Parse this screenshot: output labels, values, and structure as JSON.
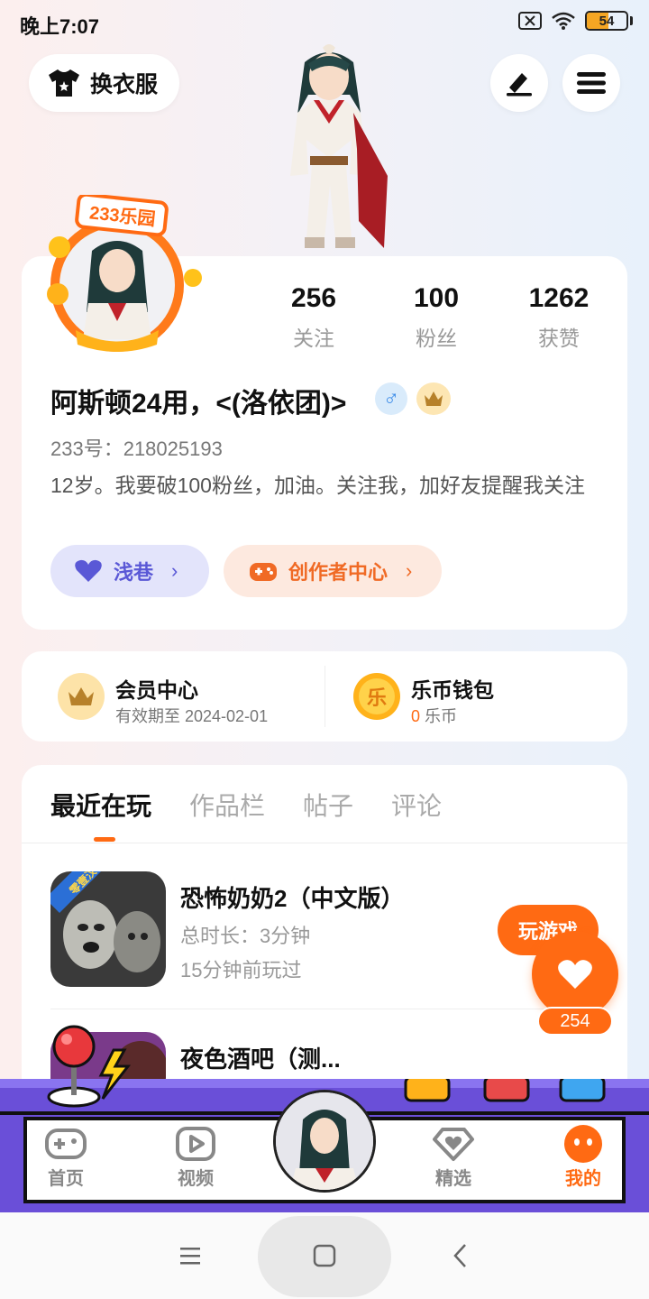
{
  "status_bar": {
    "time": "晚上7:07",
    "battery": "54"
  },
  "header": {
    "outfit_label": "换衣服"
  },
  "stats": [
    {
      "value": "256",
      "label": "关注"
    },
    {
      "value": "100",
      "label": "粉丝"
    },
    {
      "value": "1262",
      "label": "获赞"
    }
  ],
  "profile": {
    "badge_text": "233乐园",
    "nickname": "阿斯顿24用，<(洛依团)>",
    "gender_symbol": "♂",
    "uid": "233号：218025193",
    "bio": "12岁。我要破100粉丝，加油。关注我，加好友提醒我关注",
    "lane_label": "浅巷",
    "creator_label": "创作者中心"
  },
  "vip": {
    "title": "会员中心",
    "expiry": "有效期至 2024-02-01",
    "wallet_title": "乐币钱包",
    "coin_icon_text": "乐",
    "coin_amount": "0",
    "coin_unit": "乐币"
  },
  "tabs": [
    "最近在玩",
    "作品栏",
    "帖子",
    "评论"
  ],
  "games": [
    {
      "title": "恐怖奶奶2（中文版）",
      "duration": "总时长：3分钟",
      "last_played": "15分钟前玩过",
      "thumb_tag": "零壹汉化"
    },
    {
      "title": "夜色酒吧（测..."
    }
  ],
  "play_button": "玩游戏",
  "like_count": "254",
  "bottom_nav": [
    {
      "label": "首页",
      "icon": "gamepad-icon"
    },
    {
      "label": "视频",
      "icon": "play-icon"
    },
    {
      "label": "精选",
      "icon": "heart-diamond-icon"
    },
    {
      "label": "我的",
      "icon": "face-icon"
    }
  ],
  "colors": {
    "accent": "#ff6a13",
    "lane": "#5a58d6",
    "arcade": "#6a4fd8"
  }
}
